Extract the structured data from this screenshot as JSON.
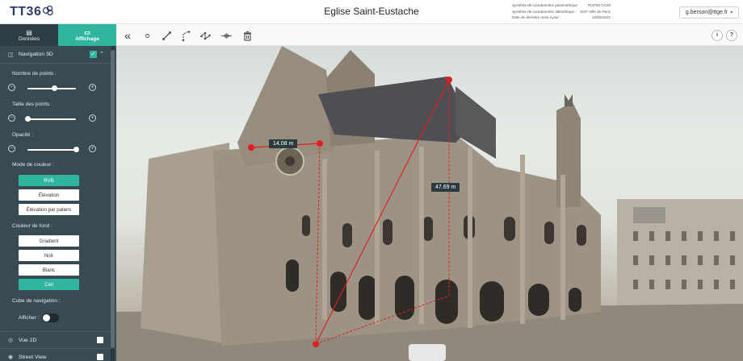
{
  "header": {
    "logo_text": "TT36",
    "title": "Eglise Saint-Eustache",
    "coordinate_info": [
      {
        "label": "Système de coordonnées planimétrique :",
        "value": "RGF93-CC48"
      },
      {
        "label": "Système de coordonnées altimétrique :",
        "value": "NGF-Ville de Paris"
      },
      {
        "label": "Date de dernière mise à jour :",
        "value": "24/06/2021"
      }
    ],
    "user_email": "g.berson@ttge.fr"
  },
  "sidebar": {
    "tabs": [
      {
        "label": "Données",
        "icon": "database-icon",
        "active": false
      },
      {
        "label": "Affichage",
        "icon": "monitor-icon",
        "active": true
      }
    ],
    "navigation_3d": {
      "title": "Navigation 3D",
      "enabled": true,
      "point_count_label": "Nombre de points :",
      "point_count_value": 0.55,
      "point_size_label": "Taille des points :",
      "point_size_value": 0.0,
      "opacity_label": "Opacité :",
      "opacity_value": 1.0,
      "color_mode_label": "Mode de couleur :",
      "color_modes": [
        "RVB",
        "Élévation",
        "Élévation par paliers"
      ],
      "color_mode_selected": "RVB",
      "background_label": "Couleur de fond :",
      "backgrounds": [
        "Gradient",
        "Noir",
        "Blanc",
        "Ciel"
      ],
      "background_selected": "Ciel",
      "nav_cube_label": "Cube de navigation :",
      "show_label": "Afficher :",
      "show_enabled": false
    },
    "bottom_items": [
      {
        "label": "Vue 2D",
        "icon": "map-icon",
        "checked": false
      },
      {
        "label": "Street View",
        "icon": "street-view-icon",
        "checked": false
      }
    ]
  },
  "toolbar": {
    "tools": [
      "collapse-icon",
      "point-icon",
      "distance-icon",
      "height-icon",
      "polyline-icon",
      "section-icon",
      "delete-icon"
    ],
    "info_label": "i",
    "help_label": "?"
  },
  "measurements": [
    {
      "label": "14.08 m"
    },
    {
      "label": "47.69 m"
    }
  ],
  "colors": {
    "accent": "#2fb5a0",
    "sidebar_bg": "#394b52",
    "measure_line": "#e02020"
  }
}
